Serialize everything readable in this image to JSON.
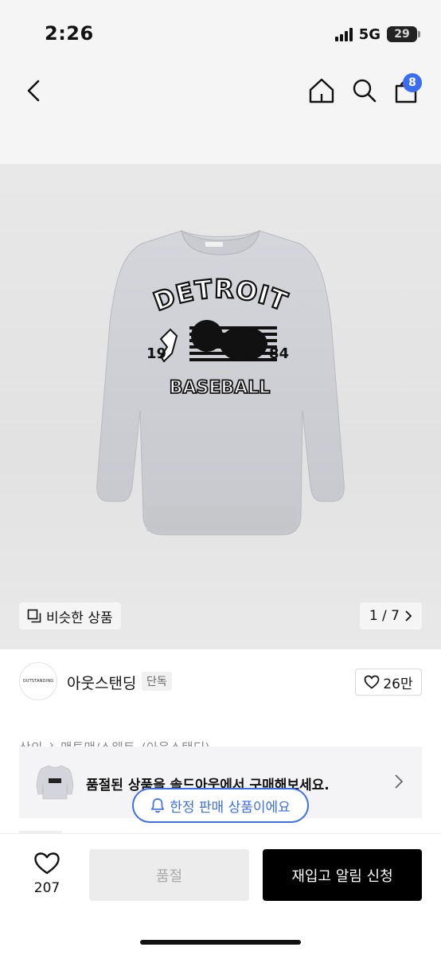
{
  "status_bar": {
    "time": "2:26",
    "network": "5G",
    "battery": "29"
  },
  "header": {
    "cart_count": "8"
  },
  "gallery": {
    "similar_label": "비슷한 상품",
    "page_indicator": "1 / 7",
    "graphic": {
      "top_text": "DETROIT",
      "year_left": "19",
      "year_right": "84",
      "bottom_text": "BASEBALL"
    }
  },
  "brand": {
    "logo_text": "OUTSTANDING",
    "name": "아웃스탠딩",
    "tag": "단독",
    "likes": "26만"
  },
  "breadcrumb": [
    "상의",
    "맨투맨/스웨트",
    "(아웃스탠딩)"
  ],
  "soldout_banner": {
    "text": "품절된 상품을 솔드아웃에서 구매해보세요."
  },
  "limited_pill": {
    "label": "한정 판매 상품이에요"
  },
  "bottom_bar": {
    "wish_count": "207",
    "soldout_label": "품절",
    "restock_label": "재입고 알림 신청"
  },
  "colors": {
    "accent": "#3a6df0",
    "primary_button": "#000000",
    "disabled_button": "#ececec"
  }
}
